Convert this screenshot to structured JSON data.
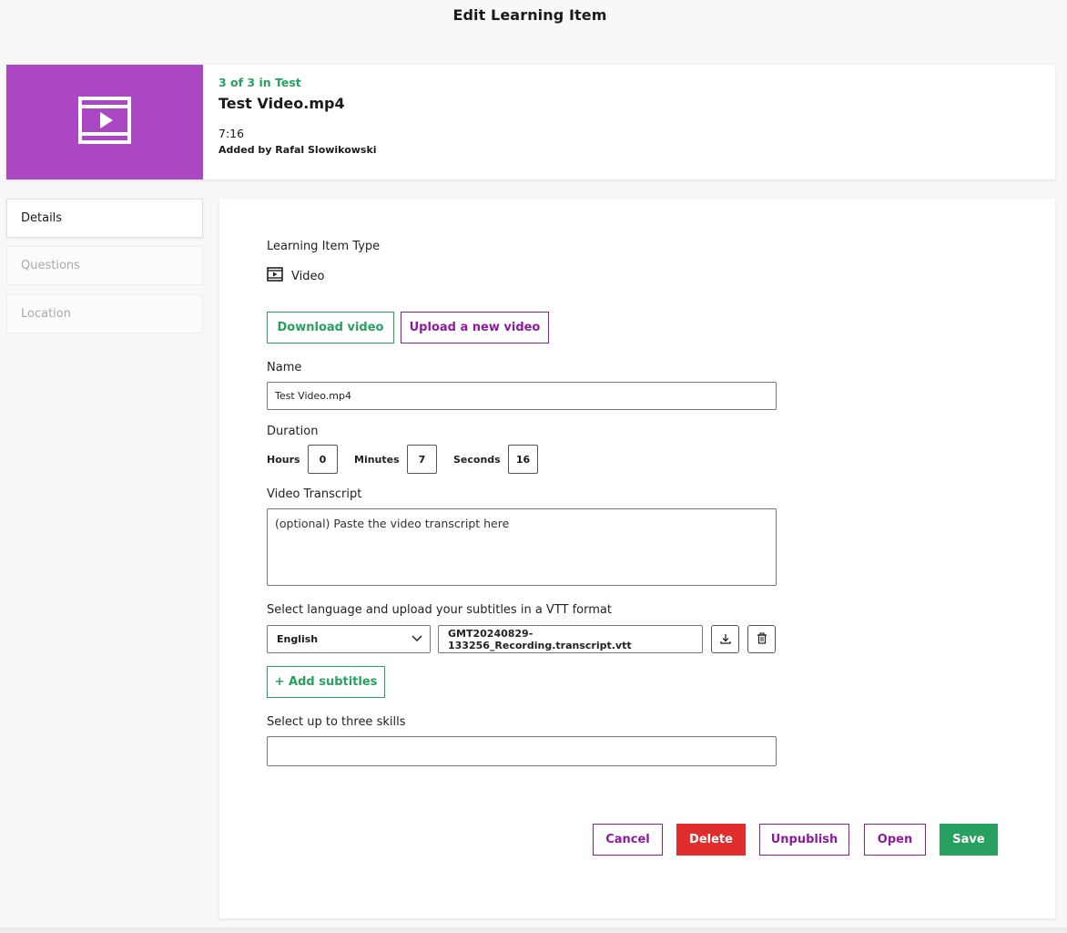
{
  "page": {
    "title": "Edit Learning Item"
  },
  "header": {
    "position": "3 of 3 in Test",
    "title": "Test Video.mp4",
    "duration": "7:16",
    "added_by": "Added by Rafal Slowikowski",
    "thumbnail_color": "#ab47c3",
    "thumbnail_icon": "video-icon"
  },
  "sidebar": {
    "tabs": [
      {
        "label": "Details",
        "active": true
      },
      {
        "label": "Questions",
        "active": false
      },
      {
        "label": "Location",
        "active": false
      }
    ]
  },
  "form": {
    "type_label": "Learning Item Type",
    "type_value": "Video",
    "download_label": "Download video",
    "upload_label": "Upload a new video",
    "name_label": "Name",
    "name_value": "Test Video.mp4",
    "duration_label": "Duration",
    "hours_label": "Hours",
    "hours_value": "0",
    "minutes_label": "Minutes",
    "minutes_value": "7",
    "seconds_label": "Seconds",
    "seconds_value": "16",
    "transcript_label": "Video Transcript",
    "transcript_placeholder": "(optional) Paste the video transcript here",
    "subtitles_label": "Select language and upload your subtitles in a VTT format",
    "language_value": "English",
    "subtitle_file": "GMT20240829-133256_Recording.transcript.vtt",
    "add_subtitles_label": "+ Add subtitles",
    "skills_label": "Select up to three skills",
    "skills_value": ""
  },
  "actions": {
    "cancel": "Cancel",
    "delete": "Delete",
    "unpublish": "Unpublish",
    "open": "Open",
    "save": "Save"
  },
  "colors": {
    "green": "#27a060",
    "purple": "#8e1b9e",
    "red": "#e02d2d"
  }
}
